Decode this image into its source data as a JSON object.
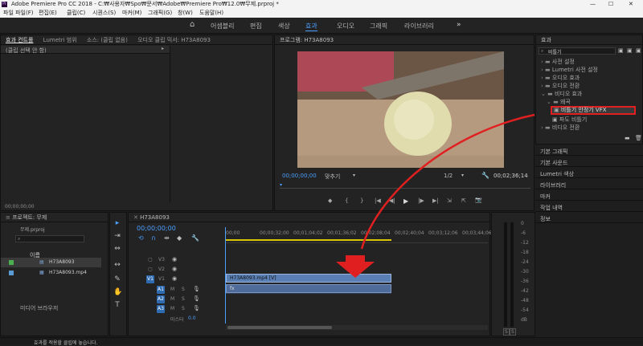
{
  "window": {
    "app_badge": "Pr",
    "title": "Adobe Premiere Pro CC 2018 - C:₩사용자₩Spo₩문서₩Adobe₩Premiere Pro₩12.0₩무제.prproj *",
    "controls": [
      "—",
      "☐",
      "✕"
    ]
  },
  "menu": [
    "파일 파일(F)",
    "편집(E)",
    "클립(C)",
    "시퀀스(S)",
    "마커(M)",
    "그래픽(G)",
    "창(W)",
    "도움말(H)"
  ],
  "workspaces": {
    "home": "⌂",
    "tabs": [
      "어셈블리",
      "편집",
      "색상",
      "효과",
      "오디오",
      "그래픽",
      "라이브러리"
    ],
    "active": "효과",
    "more": "»"
  },
  "source_panel": {
    "tabs": [
      "효과 컨트롤",
      "Lumetri 범위",
      "소스: (클립 없음)",
      "오디오 클립 믹서: H73A8093"
    ],
    "active_tab": "효과 컨트롤",
    "message": "(클립 선택 안 함)",
    "timecode": "00;00;00;00"
  },
  "program_panel": {
    "title": "프로그램: H73A8093",
    "timecode_left": "00;00;00;00",
    "fit": "맞추기",
    "resolution": "1/2",
    "timecode_right": "00;02;36;14",
    "controls": [
      "◆",
      "{",
      "}",
      "|◀",
      "◀|",
      "▶",
      "|▶",
      "▶|",
      "⇲",
      "⇱",
      "📷"
    ],
    "image_colors": {
      "board": "#b59a7f",
      "onion": "#e0dcae",
      "cloth": "#b8485a",
      "blade": "#7d7569",
      "background": "#6b5545"
    }
  },
  "effects_panel": {
    "title": "효과",
    "search_value": "비틀기",
    "tree": [
      {
        "label": "사전 설정",
        "level": 0,
        "type": "folder"
      },
      {
        "label": "Lumetri 사전 설정",
        "level": 0,
        "type": "folder"
      },
      {
        "label": "오디오 효과",
        "level": 0,
        "type": "folder"
      },
      {
        "label": "오디오 전환",
        "level": 0,
        "type": "folder"
      },
      {
        "label": "비디오 효과",
        "level": 0,
        "type": "folder",
        "open": true
      },
      {
        "label": "왜곡",
        "level": 1,
        "type": "folder",
        "open": true
      },
      {
        "label": "비틀기 안정기 VFX",
        "level": 2,
        "type": "effect",
        "highlighted": true
      },
      {
        "label": "파도 비틀기",
        "level": 2,
        "type": "effect"
      },
      {
        "label": "비디오 전환",
        "level": 0,
        "type": "folder"
      }
    ],
    "collapsed_panels": [
      "기본 그래픽",
      "기본 사운드",
      "Lumetri 색상",
      "라이브러리",
      "마커",
      "작업 내역",
      "정보"
    ],
    "highlight_color": "#e02020"
  },
  "project_panel": {
    "title": "프로젝트: 무제",
    "file": "무제.prproj",
    "column_name": "이름",
    "items": [
      {
        "name": "H73A8093",
        "color": "#4caf50",
        "kind": "sequence"
      },
      {
        "name": "H73A8093.mp4",
        "color": "#5b9bd5",
        "kind": "video"
      }
    ],
    "media_browser": "미디어 브라우저"
  },
  "timeline": {
    "title": "H73A8093",
    "timecode": "00;00;00;00",
    "ruler": [
      "00;00",
      "00;00;32;00",
      "00;01;04;02",
      "00;01;36;02",
      "00;02;08;04",
      "00;02;40;04",
      "00;03;12;06",
      "00;03;44;06"
    ],
    "video_tracks": [
      "V3",
      "V2",
      "V1"
    ],
    "audio_tracks": [
      "A1",
      "A2",
      "A3"
    ],
    "master_label": "마스터",
    "master_value": "0.0",
    "clip_label": "H73A8093.mp4 [V]",
    "audio_clip_symbol": "fx",
    "clip_color": "#5a7fb4"
  },
  "audio_meter": {
    "scale": [
      "0",
      "-6",
      "-12",
      "-18",
      "-24",
      "-30",
      "-36",
      "-42",
      "-48",
      "-54",
      "dB"
    ],
    "solo": [
      "S",
      "S"
    ]
  },
  "tools": [
    "▸",
    "⇥",
    "⇔",
    "↔",
    "✎",
    "✋",
    "T"
  ],
  "status_bar": {
    "message": "효과를 적용할 클립에 놓습니다."
  }
}
